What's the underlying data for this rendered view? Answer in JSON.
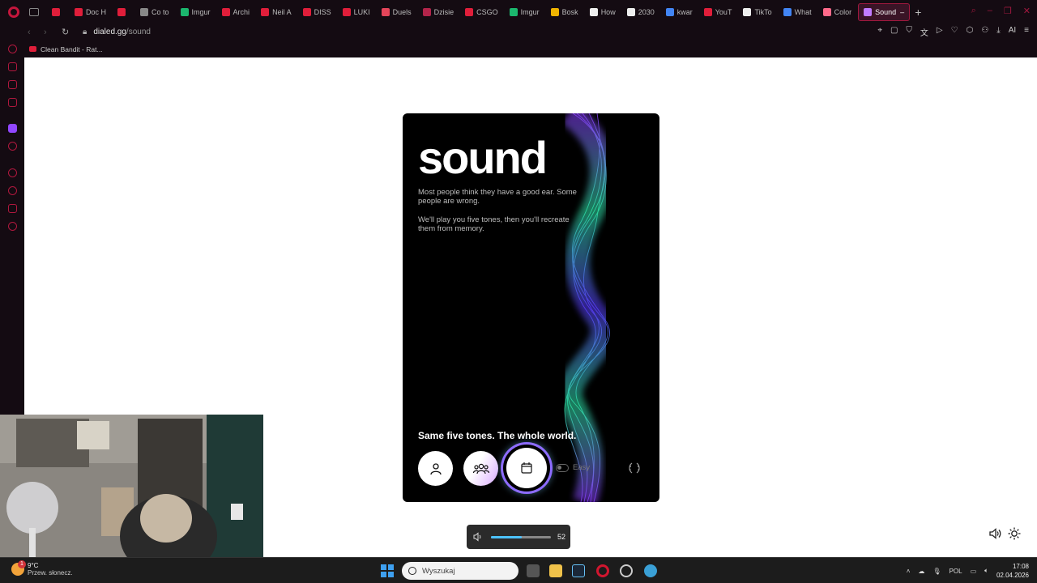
{
  "browser": {
    "tabs": [
      {
        "label": "",
        "fav": "#e01e3a"
      },
      {
        "label": "Doc H",
        "fav": "#e01e3a"
      },
      {
        "label": "",
        "fav": "#e01e3a"
      },
      {
        "label": "Co to",
        "fav": "#888"
      },
      {
        "label": "Imgur",
        "fav": "#1bb76e"
      },
      {
        "label": "Archi",
        "fav": "#e01e3a"
      },
      {
        "label": "Neil A",
        "fav": "#e01e3a"
      },
      {
        "label": "DISS",
        "fav": "#e01e3a"
      },
      {
        "label": "LUKI",
        "fav": "#e01e3a"
      },
      {
        "label": "Duels",
        "fav": "#e4455a"
      },
      {
        "label": "Dzisie",
        "fav": "#b2244a"
      },
      {
        "label": "CSGO",
        "fav": "#e01e3a"
      },
      {
        "label": "Imgur",
        "fav": "#1bb76e"
      },
      {
        "label": "Bosk",
        "fav": "#f0b400"
      },
      {
        "label": "How",
        "fav": "#eeeeee"
      },
      {
        "label": "2030",
        "fav": "#eeeeee"
      },
      {
        "label": "kwar",
        "fav": "#4285f4"
      },
      {
        "label": "YouT",
        "fav": "#e01e3a"
      },
      {
        "label": "TikTo",
        "fav": "#eeeeee"
      },
      {
        "label": "What",
        "fav": "#4285f4"
      },
      {
        "label": "Color",
        "fav": "#ff6a8a"
      },
      {
        "label": "Sound",
        "fav": "#c17cff",
        "active": true
      }
    ],
    "url_domain": "dialed.gg",
    "url_path": "/sound",
    "bookmark": "Clean Bandit - Rat...",
    "ai_label": "AI"
  },
  "page": {
    "title": "sound",
    "desc1": "Most people think they have a good ear. Some people are wrong.",
    "desc2": "We'll play you five tones, then you'll recreate them from memory.",
    "tagline": "Same five tones. The whole world.",
    "toggle_label": "Easy"
  },
  "osd": {
    "volume": 52,
    "volume_fraction": 0.52
  },
  "taskbar": {
    "temp": "9°C",
    "condition": "Przew. słonecz.",
    "badge": "1",
    "search_placeholder": "Wyszukaj",
    "lang": "POL",
    "time": "17:08",
    "date": "02.04.2026"
  },
  "icons": {
    "solo": "person-icon",
    "group": "people-icon",
    "daily": "calendar-icon",
    "leaderboard": "laurel-icon"
  },
  "colors": {
    "accent": "#c4163c",
    "volume_fill": "#4cc2ff",
    "wave_green": "#2ee6a8",
    "wave_purple": "#8a3cff"
  }
}
